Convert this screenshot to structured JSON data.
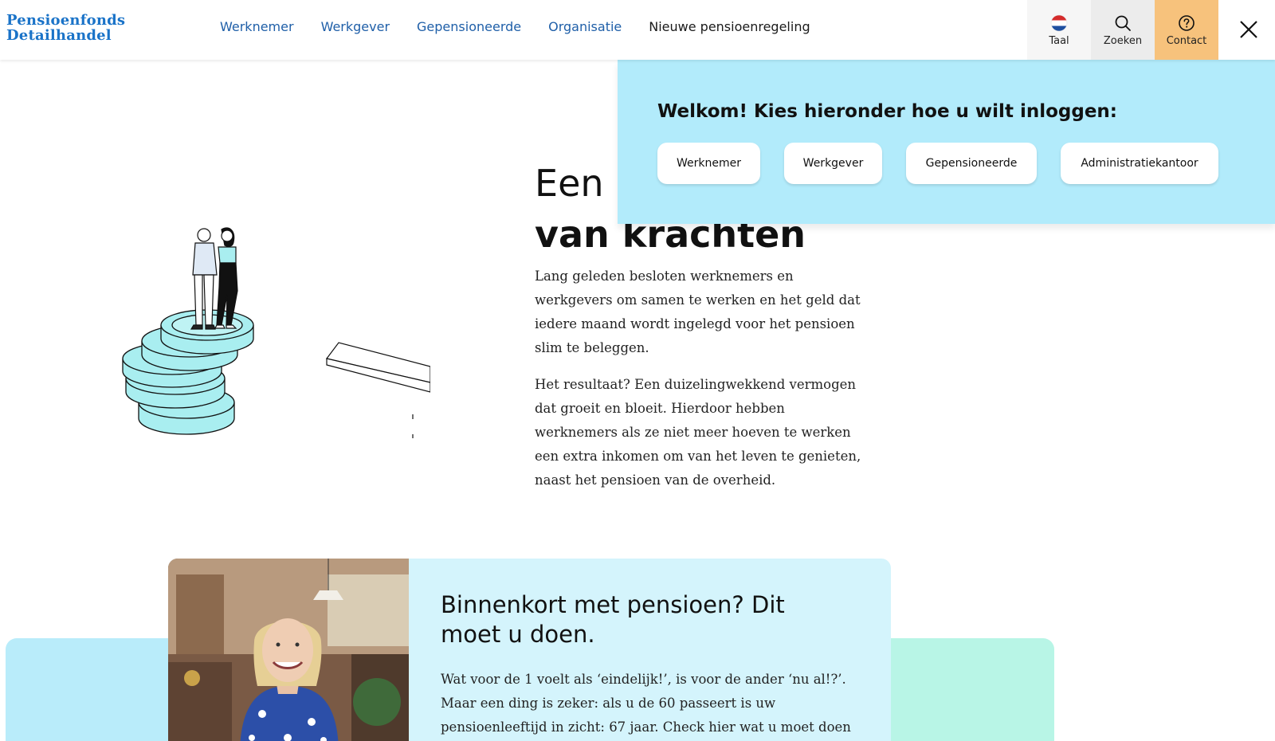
{
  "header": {
    "logo_line1": "Pensioenfonds",
    "logo_line2": "Detailhandel",
    "nav": [
      "Werknemer",
      "Werkgever",
      "Gepensioneerde",
      "Organisatie",
      "Nieuwe pensioenregeling"
    ],
    "taal_label": "Taal",
    "zoeken_label": "Zoeken",
    "contact_label": "Contact"
  },
  "login": {
    "title": "Welkom! Kies hieronder hoe u wilt inloggen:",
    "buttons": [
      "Werknemer",
      "Werkgever",
      "Gepensioneerde",
      "Administratiekantoor"
    ]
  },
  "hero": {
    "title_line1": "Een b",
    "title_line2": "van krachten",
    "para1": "Lang geleden besloten werknemers en werkgevers om samen te werken en het geld dat iedere maand wordt ingelegd voor het pensioen slim te beleggen.",
    "para2": "Het resultaat? Een duizelingwekkend vermogen dat groeit en bloeit. Hierdoor hebben werknemers als ze niet meer hoeven te werken een extra inkomen om van het leven te genieten, naast het pensioen van de overheid."
  },
  "card": {
    "title": "Binnenkort met pensioen? Dit moet u doen.",
    "text": "Wat voor de 1 voelt als ‘eindelijk!’, is voor de ander ‘nu al!?’. Maar een ding is zeker: als u de 60 passeert is uw pensioenleeftijd in zicht: 67 jaar. Check hier wat u moet doen om straks te kunnen"
  },
  "colors": {
    "brand_blue": "#1a73c8",
    "nav_blue": "#1f5fa8",
    "login_bg": "#b2ebfb",
    "contact_bg": "#f7c27c",
    "coin": "#a9eef0"
  }
}
